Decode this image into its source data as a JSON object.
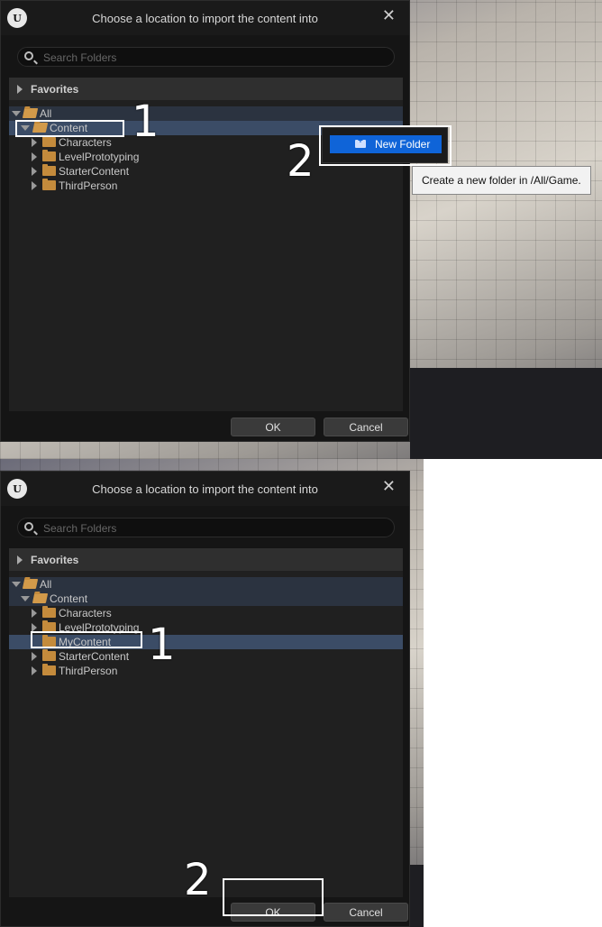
{
  "dialog": {
    "title": "Choose a location to import the content into",
    "logo": "U",
    "close_icon": "✕",
    "search_placeholder": "Search Folders",
    "favorites_label": "Favorites",
    "ok_label": "OK",
    "cancel_label": "Cancel"
  },
  "top": {
    "tree": [
      "All",
      "Content",
      "Characters",
      "LevelPrototyping",
      "StarterContent",
      "ThirdPerson"
    ],
    "context_menu_item": "New Folder",
    "tooltip": "Create a new folder in /All/Game.",
    "step1": "1",
    "step2": "2"
  },
  "bottom": {
    "tree": [
      "All",
      "Content",
      "Characters",
      "LevelPrototyping",
      "MyContent",
      "StarterContent",
      "ThirdPerson"
    ],
    "step1": "1",
    "step2": "2"
  },
  "icons": {
    "logo": "unreal-logo-icon",
    "close": "close-icon",
    "search": "search-icon",
    "folder": "folder-icon",
    "new_folder": "new-folder-icon"
  },
  "colors": {
    "accent": "#0f64d8",
    "selection": "#3b4c66",
    "folder": "#c48b3c"
  }
}
